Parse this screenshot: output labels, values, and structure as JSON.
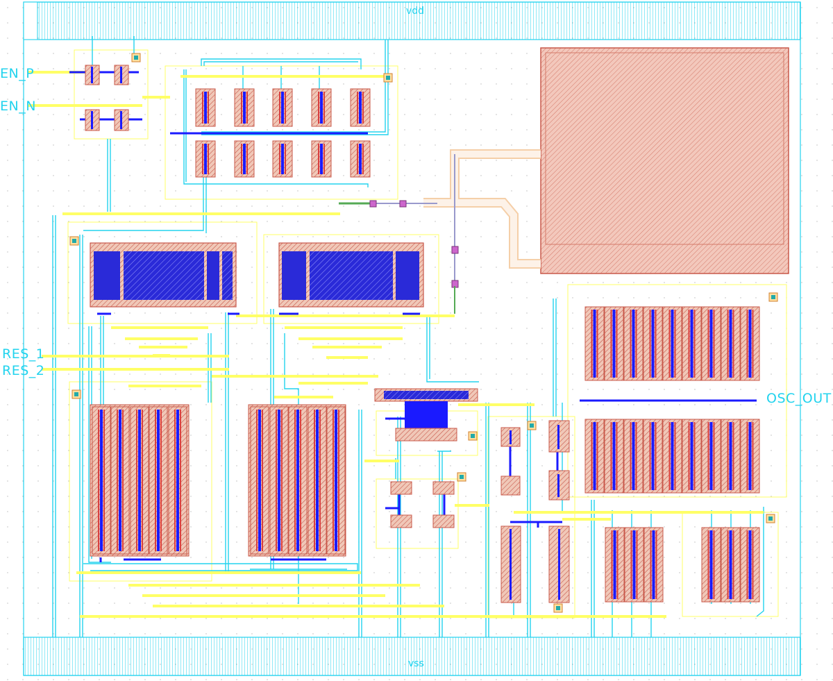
{
  "rails": {
    "top": "vdd",
    "bottom": "vss"
  },
  "pins": {
    "en_p": "EN_P",
    "en_n": "EN_N",
    "res1": "RES_1",
    "res2": "RES_2",
    "osc_out": "OSC_OUT"
  },
  "colors": {
    "metal1": "#22d3ee",
    "metal2": "#ffff66",
    "poly": "#d94040",
    "diffusion": "#c8705a",
    "via": "#1a1aff",
    "contact": "#2233cc",
    "pad": "#e8a090",
    "background": "#ffffff",
    "grid": "#c0c0c0"
  }
}
